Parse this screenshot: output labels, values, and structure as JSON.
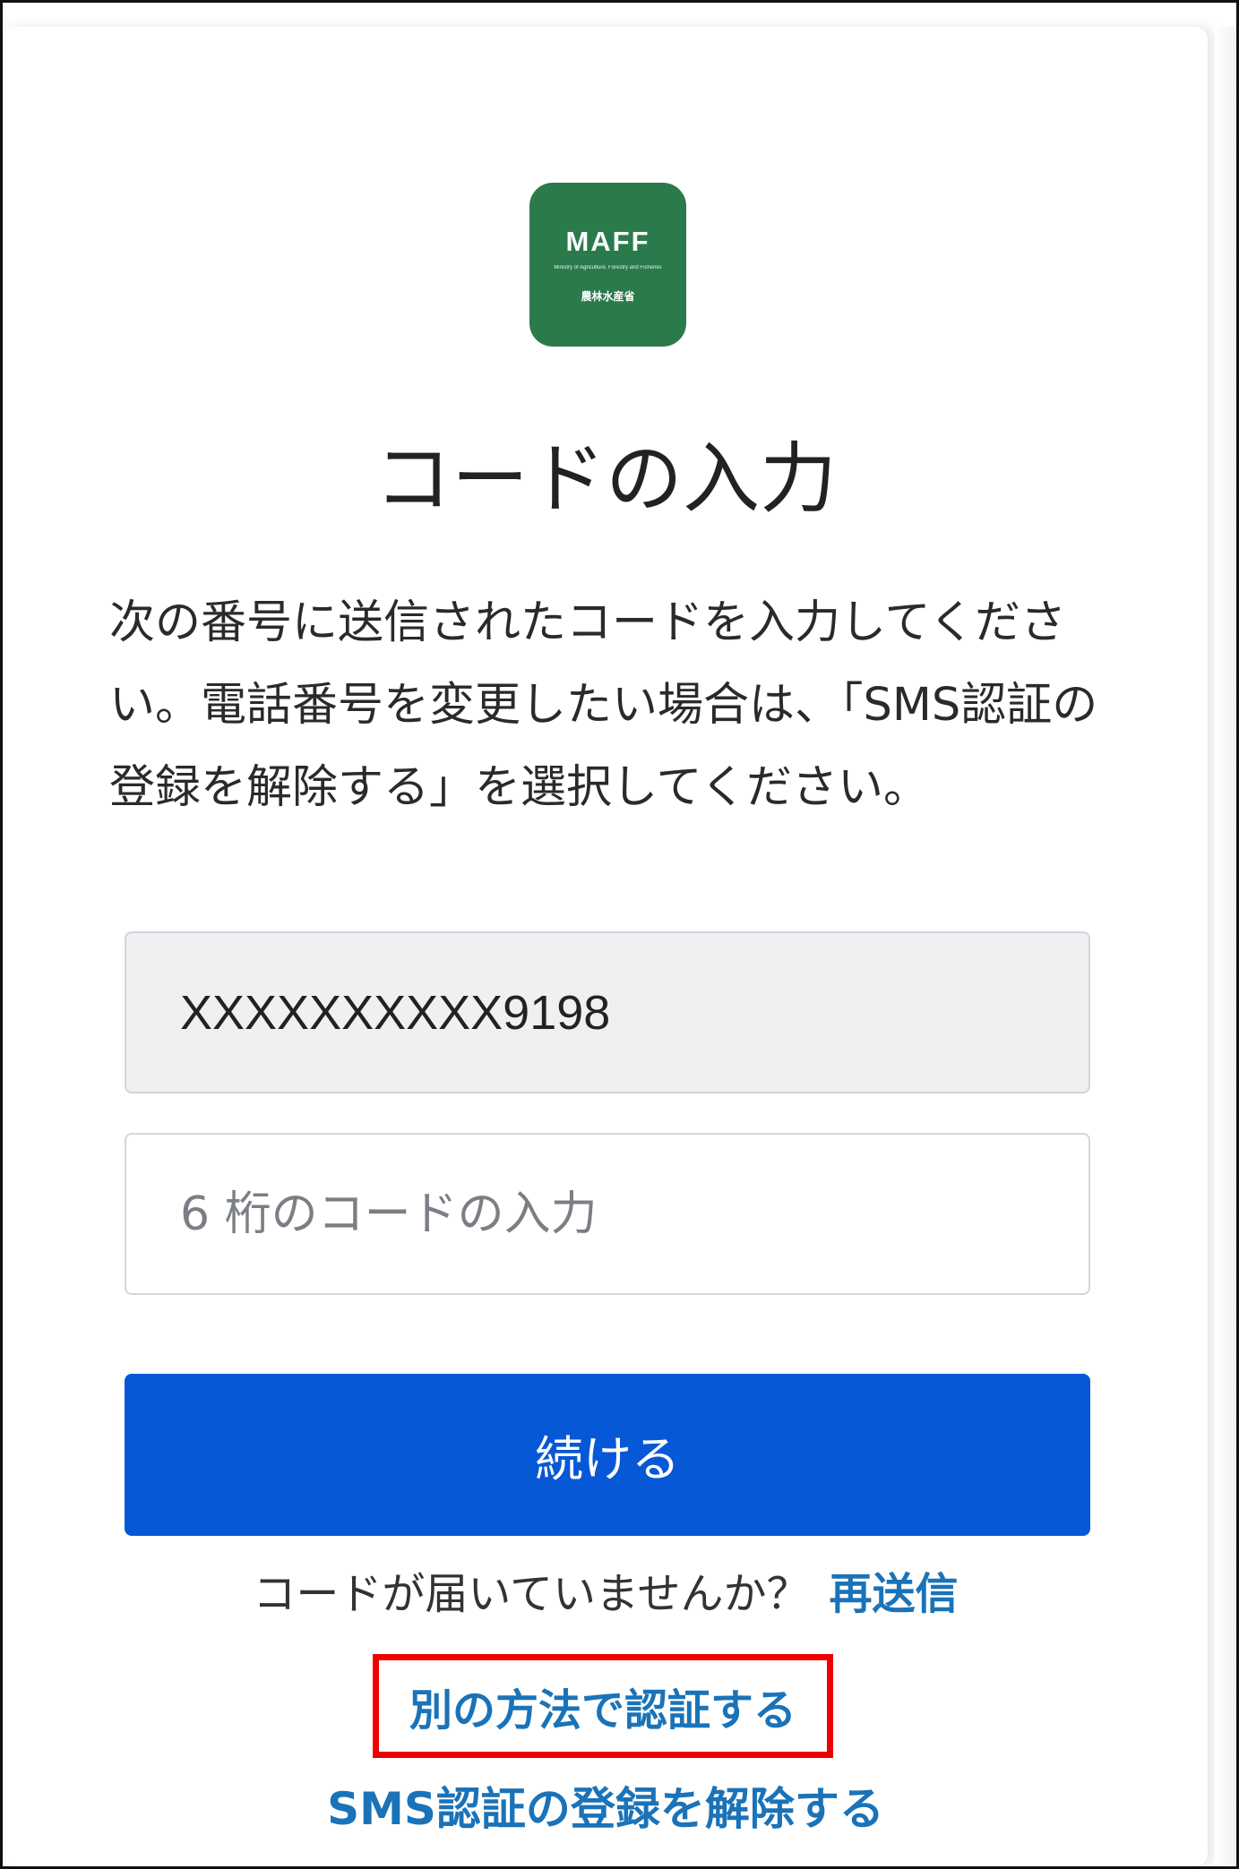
{
  "logo": {
    "main_text": "MAFF",
    "sub_text": "Ministry of Agriculture, Forestry and Fisheries",
    "jp_text": "農林水産省"
  },
  "title": "コードの入力",
  "description": "次の番号に送信されたコードを入力してください。電話番号を変更したい場合は、「SMS認証の登録を解除する」を選択してください。",
  "phone_field": {
    "value": "XXXXXXXXXX9198"
  },
  "code_field": {
    "value": "",
    "placeholder": "6 桁のコードの入力"
  },
  "continue_button": {
    "label": "続ける"
  },
  "resend": {
    "prompt": "コードが届いていませんか？",
    "link_label": "再送信"
  },
  "alt_method_link": {
    "label": "別の方法で認証する"
  },
  "deregister_link": {
    "label": "SMS認証の登録を解除する"
  },
  "colors": {
    "brand_green": "#2b7a4c",
    "primary_button": "#0758d6",
    "link": "#1a73b8",
    "highlight": "#ee0000"
  }
}
